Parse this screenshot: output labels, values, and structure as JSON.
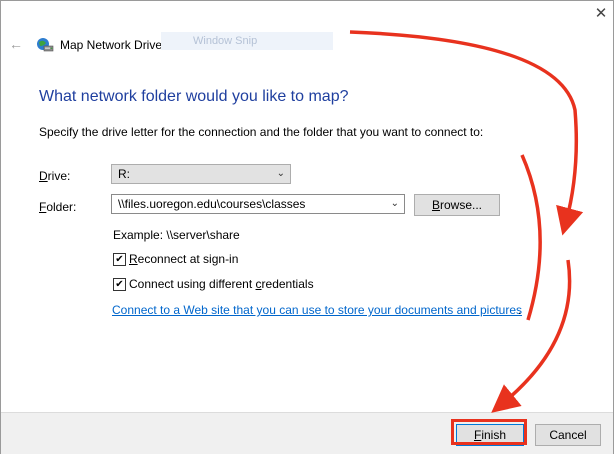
{
  "window": {
    "title": "Map Network Drive",
    "snip_overlay": "Window Snip",
    "close_glyph": "✕",
    "back_glyph": "←"
  },
  "content": {
    "heading": "What network folder would you like to map?",
    "instruction": "Specify the drive letter for the connection and the folder that you want to connect to:",
    "drive": {
      "label_accel": "D",
      "label_rest": "rive:",
      "value": "R:"
    },
    "folder": {
      "label_accel": "F",
      "label_rest": "older:",
      "value": "\\\\files.uoregon.edu\\courses\\classes",
      "browse_accel": "B",
      "browse_rest": "rowse..."
    },
    "example": "Example: \\\\server\\share",
    "reconnect": {
      "checked": true,
      "accel": "R",
      "rest": "econnect at sign-in"
    },
    "credentials": {
      "checked": true,
      "before": "Connect using different ",
      "accel": "c",
      "after": "redentials"
    },
    "link": "Connect to a Web site that you can use to store your documents and pictures",
    "link_suffix": "."
  },
  "footer": {
    "finish_accel": "F",
    "finish_rest": "inish",
    "cancel": "Cancel"
  },
  "annotation": {
    "color": "#e8321e"
  },
  "icons": {
    "check": "✔",
    "chevron": "⌄"
  }
}
